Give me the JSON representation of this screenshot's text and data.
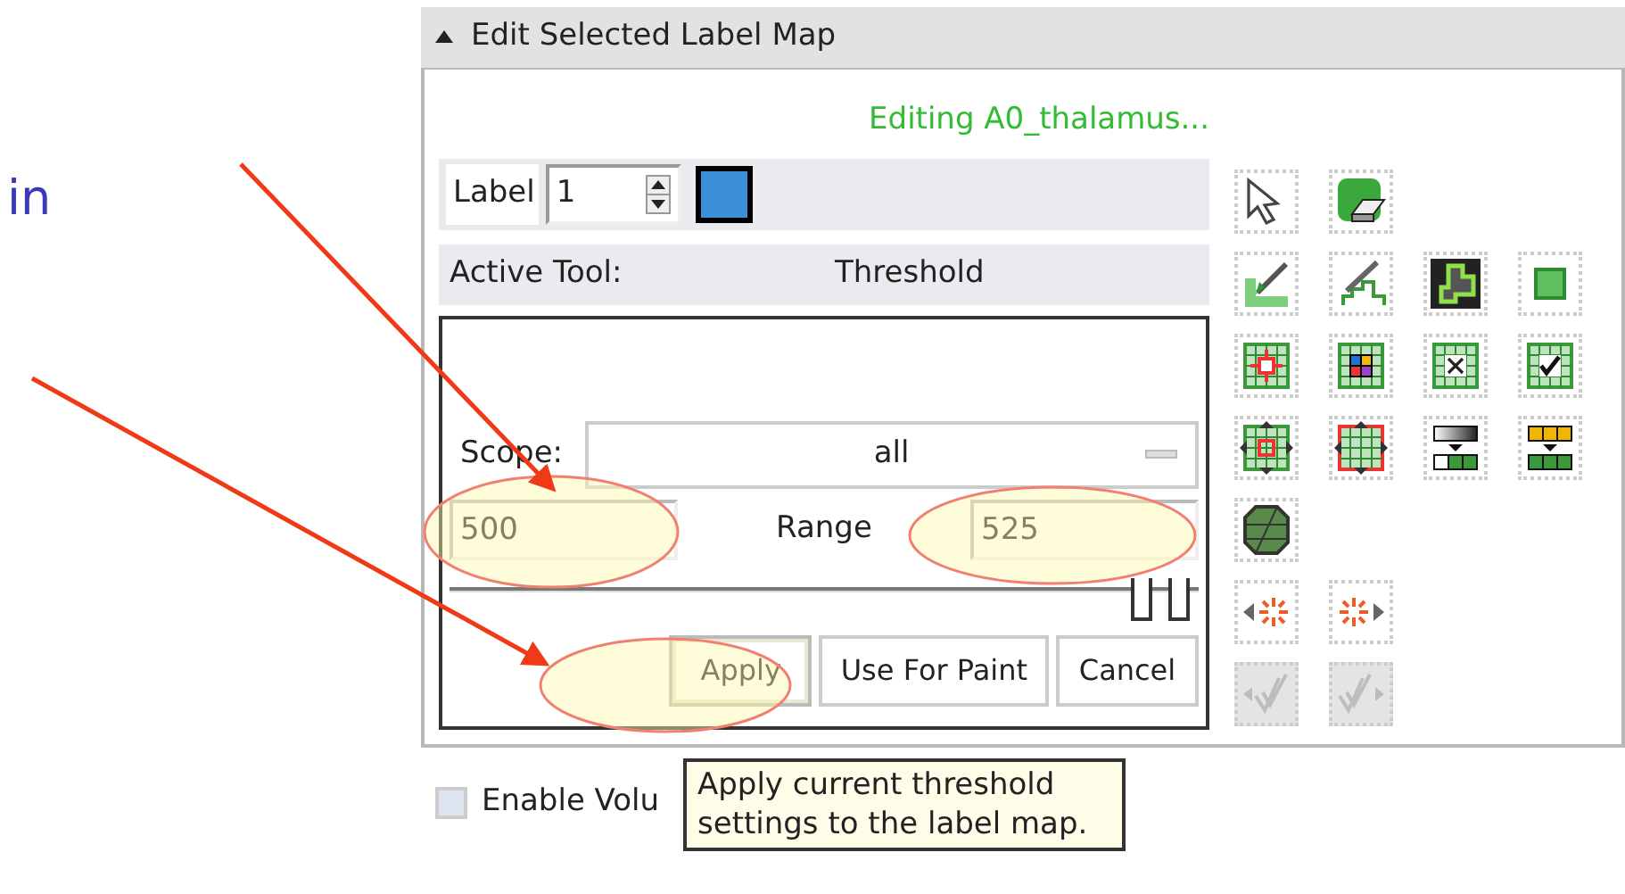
{
  "slide": {
    "side_text": "in"
  },
  "panel": {
    "title": "Edit Selected Label Map",
    "expanded": true,
    "status": "Editing A0_thalamus...",
    "label": {
      "caption": "Label",
      "value": "1",
      "color": "#3a8fd6"
    },
    "active_tool": {
      "caption": "Active Tool:",
      "value": "Threshold"
    },
    "threshold": {
      "scope_caption": "Scope:",
      "scope_value": "all",
      "range_min": "500",
      "range_caption": "Range",
      "range_max": "525",
      "slider": {
        "thumbs": [
          {
            "level": 0.925
          },
          {
            "level": 0.975
          }
        ]
      },
      "buttons": [
        {
          "label": "Apply",
          "highlighted": true
        },
        {
          "label": "Use For Paint",
          "highlighted": false
        },
        {
          "label": "Cancel",
          "highlighted": false
        }
      ]
    },
    "tool_rows": [
      [
        {
          "disabled": false
        },
        {
          "disabled": false
        }
      ],
      [
        {
          "disabled": false
        },
        {
          "disabled": false
        },
        {
          "disabled": false
        },
        {
          "disabled": false
        }
      ],
      [
        {
          "disabled": false
        },
        {
          "disabled": false
        },
        {
          "disabled": false
        },
        {
          "disabled": false
        }
      ],
      [
        {
          "disabled": false
        },
        {
          "disabled": false
        },
        {
          "disabled": false
        },
        {
          "disabled": false
        }
      ],
      [
        {
          "disabled": false
        }
      ],
      [
        {
          "disabled": false
        },
        {
          "disabled": false
        }
      ],
      [
        {
          "disabled": true
        },
        {
          "disabled": true
        }
      ]
    ]
  },
  "volume_option": {
    "label": "Enable Volu",
    "checked": false
  },
  "tooltip": {
    "text": "Apply current threshold settings to the label map."
  }
}
